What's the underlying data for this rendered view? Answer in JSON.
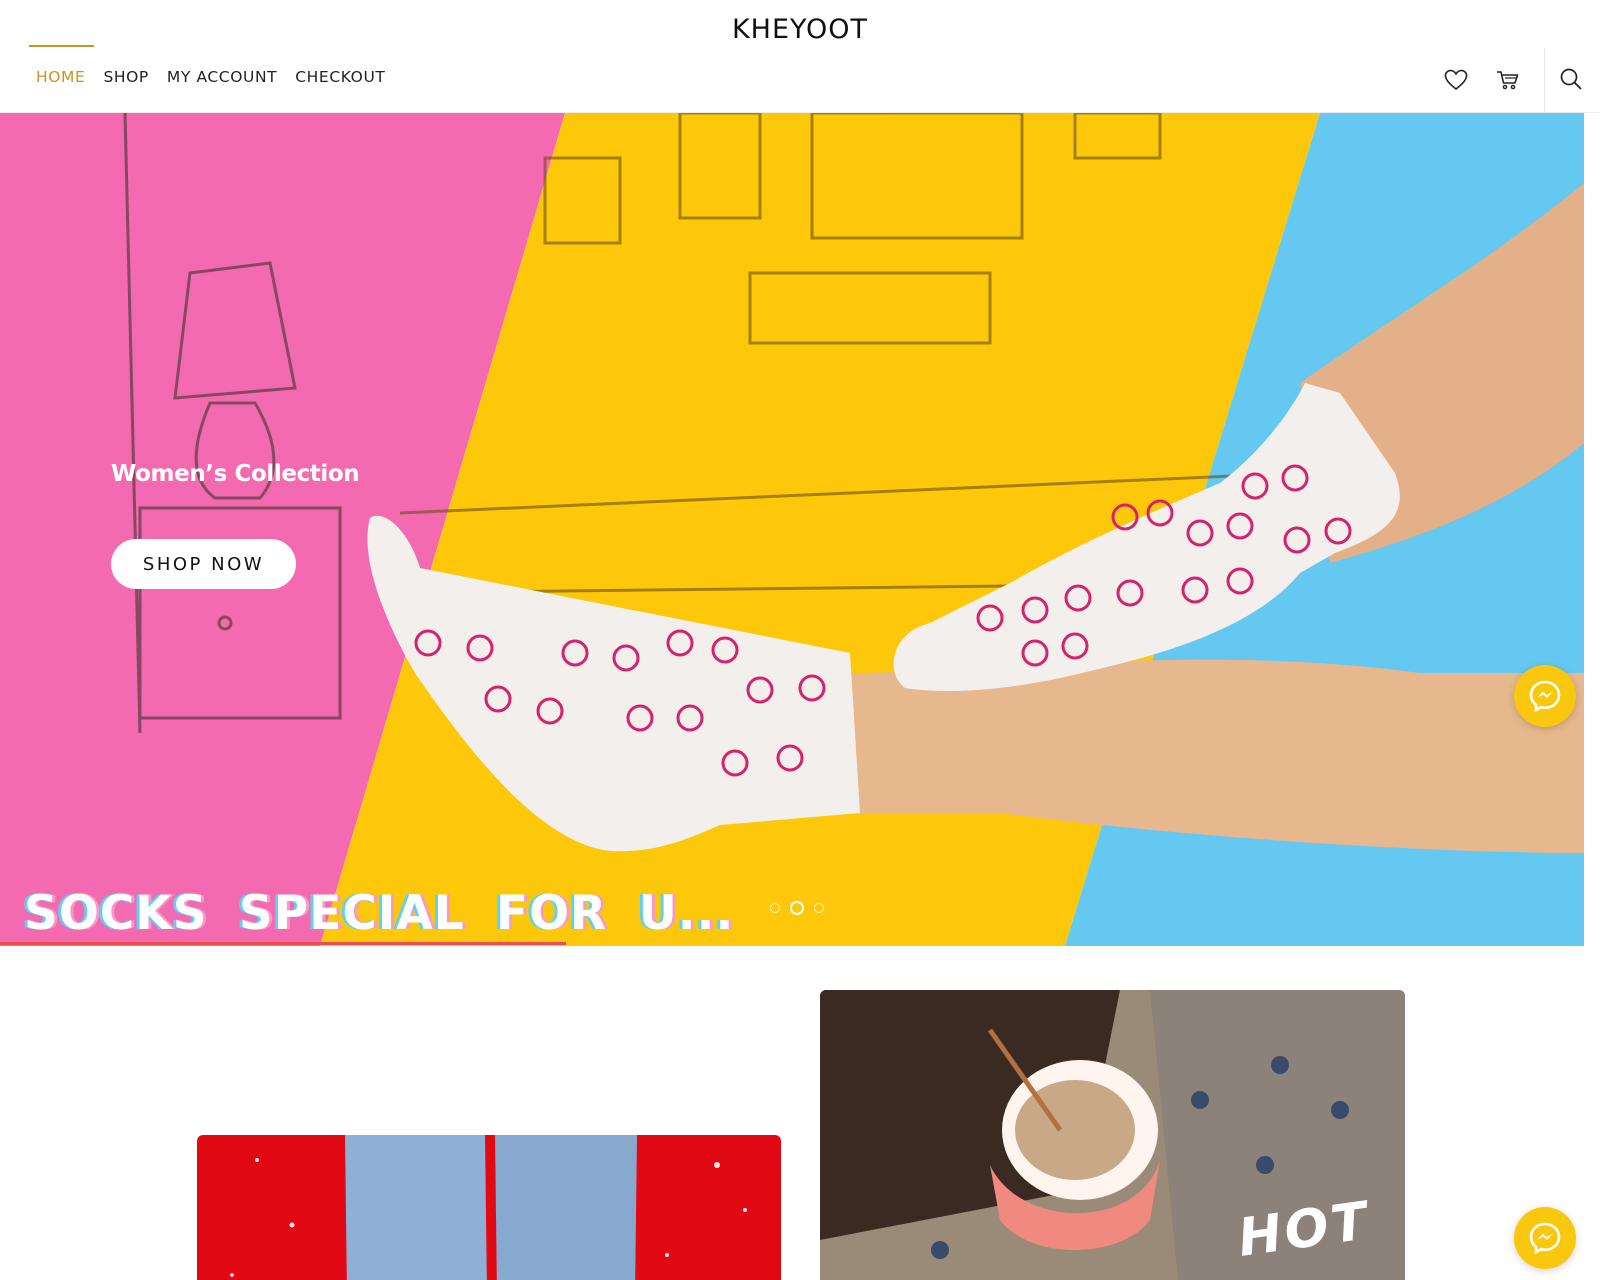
{
  "header": {
    "brand": "KHEYOOT",
    "nav": [
      {
        "label": "HOME",
        "active": true
      },
      {
        "label": "SHOP",
        "active": false
      },
      {
        "label": "MY ACCOUNT",
        "active": false
      },
      {
        "label": "CHECKOUT",
        "active": false
      }
    ],
    "icons": [
      "heart-icon",
      "cart-icon",
      "search-icon"
    ]
  },
  "hero": {
    "subtitle": "Women’s Collection",
    "button_label": "SHOP NOW",
    "tagline": "SOCKS SPECIAL FOR U...",
    "slides_total": 3,
    "active_slide": 2
  },
  "cards": {
    "right_overlay_text": "HOT"
  },
  "colors": {
    "accent": "#c8951e",
    "hero_pink": "#f46ab0",
    "hero_yellow": "#fec80a",
    "hero_blue": "#64c8f0",
    "messenger": "#f9c80e",
    "card_red": "#e10a14"
  }
}
